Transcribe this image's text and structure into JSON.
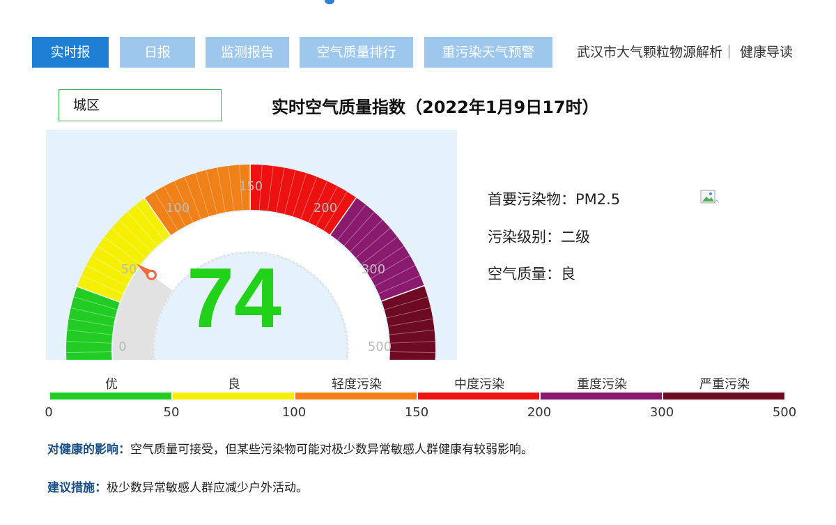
{
  "nav": {
    "tabs": [
      {
        "label": "实时报",
        "active": true
      },
      {
        "label": "日报",
        "active": false
      },
      {
        "label": "监测报告",
        "active": false
      },
      {
        "label": "空气质量排行",
        "active": false
      },
      {
        "label": "重污染天气预警",
        "active": false
      }
    ],
    "links_text": "武汉市大气颗粒物源解析｜ 健康导读"
  },
  "region": {
    "value": "城区"
  },
  "title": "实时空气质量指数（2022年1月9日17时）",
  "gauge": {
    "value": "74",
    "ticks": [
      "0",
      "50",
      "100",
      "150",
      "200",
      "300",
      "500"
    ],
    "value_color": "#22d11a"
  },
  "info": {
    "primary_pollutant": "首要污染物：PM2.5",
    "level": "污染级别：二级",
    "quality": "空气质量：良"
  },
  "scale": {
    "categories": [
      {
        "label": "优",
        "color": "#22cc22"
      },
      {
        "label": "良",
        "color": "#f5f000"
      },
      {
        "label": "轻度污染",
        "color": "#f08018"
      },
      {
        "label": "中度污染",
        "color": "#ee1111"
      },
      {
        "label": "重度污染",
        "color": "#8a1a6e"
      },
      {
        "label": "严重污染",
        "color": "#6e0a22"
      }
    ],
    "ticks": [
      "0",
      "50",
      "100",
      "150",
      "200",
      "300",
      "500"
    ]
  },
  "health": {
    "label": "对健康的影响：",
    "text": "空气质量可接受，但某些污染物可能对极少数异常敏感人群健康有较弱影响。"
  },
  "advice": {
    "label": "建议措施：",
    "text": "极少数异常敏感人群应减少户外活动。"
  },
  "colors": {
    "accent": "#1e7fd5",
    "inactive_tab": "#9ec7ee",
    "gauge_bg": "#e6f2fb"
  }
}
